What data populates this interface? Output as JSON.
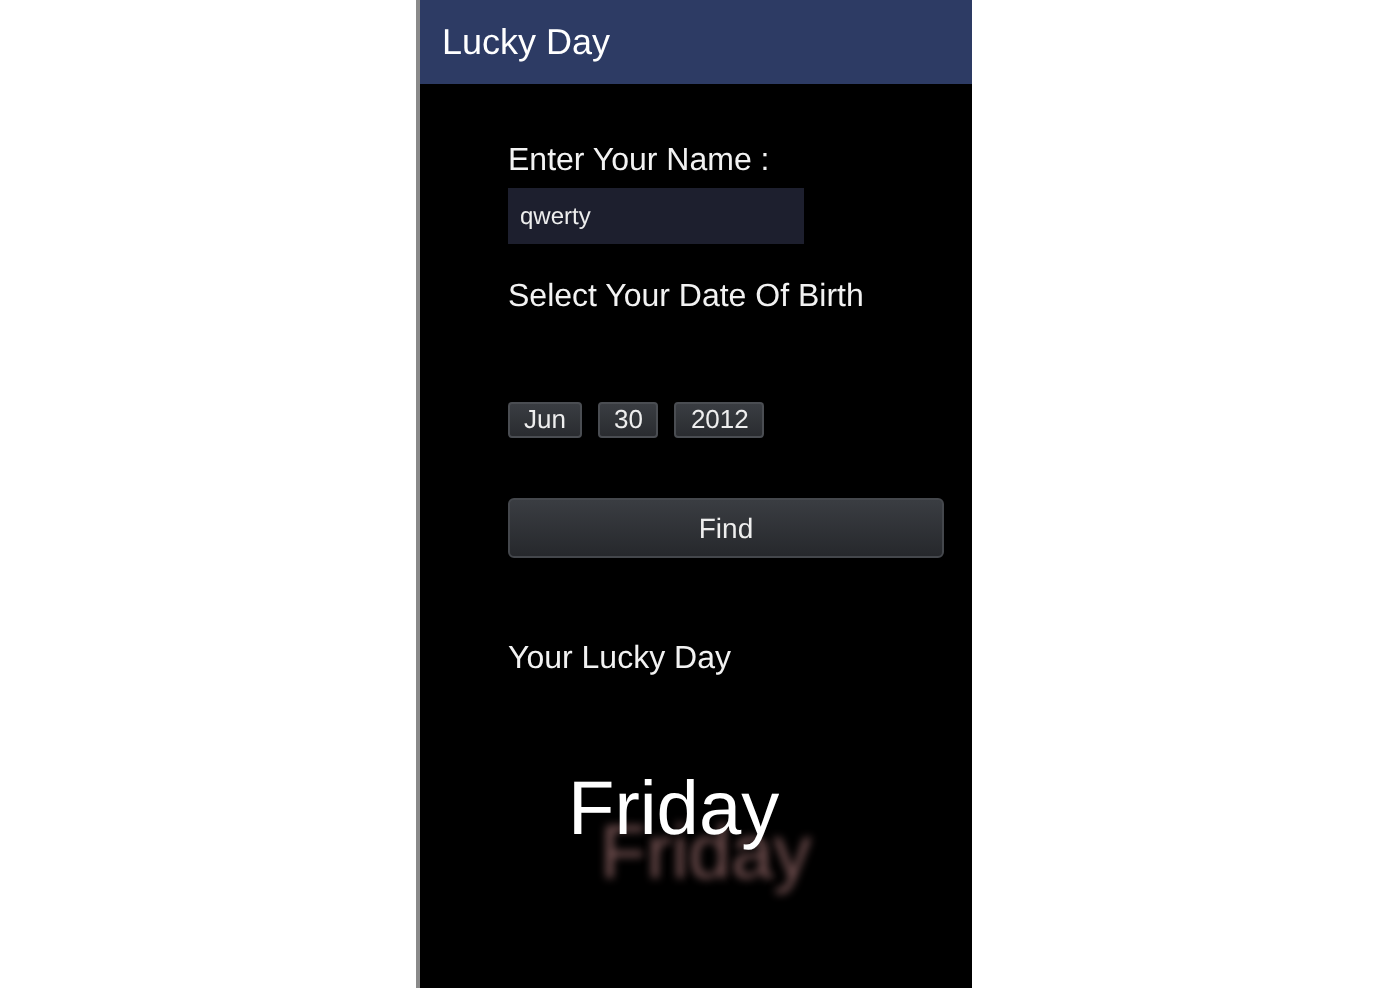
{
  "window": {
    "title": "Lucky Day"
  },
  "name_field": {
    "label": "Enter Your Name :",
    "value": "qwerty"
  },
  "date_of_birth": {
    "label": "Select Your Date Of Birth",
    "month": "Jun",
    "day": "30",
    "year": "2012"
  },
  "find_button": {
    "label": "Find"
  },
  "result": {
    "label": "Your Lucky Day",
    "day": "Friday"
  }
}
